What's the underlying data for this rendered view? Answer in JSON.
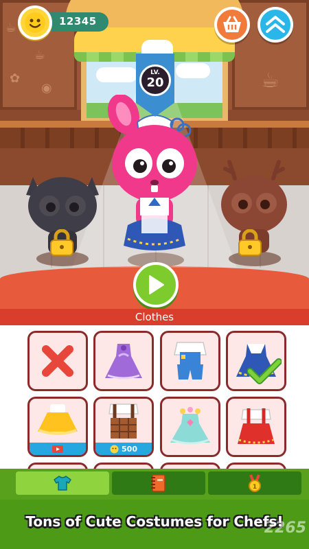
{
  "hud": {
    "coins": "12345",
    "coin_icon": "smiley-coin-icon",
    "basket_icon": "shopping-basket-icon",
    "home_icon": "home-up-arrow-icon"
  },
  "level": {
    "label": "LV.",
    "value": "20"
  },
  "characters": [
    {
      "name": "black-cat",
      "locked": true
    },
    {
      "name": "pink-bunny",
      "locked": false,
      "selected": true
    },
    {
      "name": "brown-deer",
      "locked": true
    }
  ],
  "play_icon": "play-triangle-icon",
  "category": {
    "title": "Clothes"
  },
  "items": [
    {
      "name": "none",
      "icon": "red-x-icon"
    },
    {
      "name": "purple-gown",
      "icon": "dress-icon"
    },
    {
      "name": "blue-overalls",
      "icon": "overalls-icon"
    },
    {
      "name": "blue-sailor-dress",
      "icon": "dress-icon",
      "equipped": true
    },
    {
      "name": "yellow-tutu",
      "icon": "dress-icon",
      "tag_icon": "video-ad-icon"
    },
    {
      "name": "brown-check-overalls",
      "icon": "overalls-icon",
      "price": "500"
    },
    {
      "name": "teal-flower-dress",
      "icon": "dress-icon"
    },
    {
      "name": "red-suspender-skirt",
      "icon": "skirt-icon"
    }
  ],
  "tabs": [
    {
      "icon": "shirt-icon",
      "active": true
    },
    {
      "icon": "book-icon",
      "active": false
    },
    {
      "icon": "medal-icon",
      "active": false
    }
  ],
  "caption": "Tons of Cute Costumes for Chefs!",
  "watermark": "2265",
  "colors": {
    "accent_red": "#d93d2c",
    "coin_yellow": "#ffd63a",
    "tab_green": "#57a11c",
    "sky_blue": "#29b6e8"
  }
}
